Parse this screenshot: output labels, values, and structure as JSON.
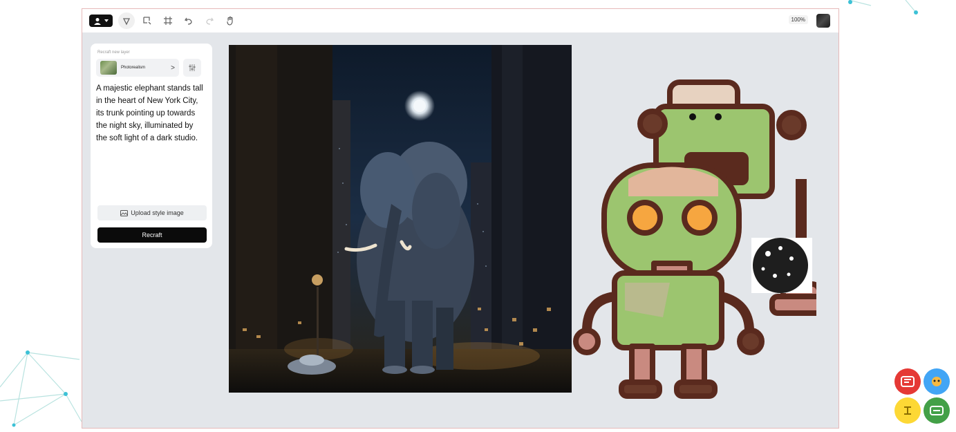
{
  "toolbar": {
    "tools": [
      {
        "icon": "lasso-select-icon"
      },
      {
        "icon": "crop-region-icon"
      },
      {
        "icon": "frame-icon"
      },
      {
        "icon": "undo-icon"
      },
      {
        "icon": "redo-icon",
        "disabled": true
      },
      {
        "icon": "hand-pan-icon"
      }
    ],
    "zoom": "100%"
  },
  "panel": {
    "title": "Recraft new layer",
    "style_label": "Photorealism",
    "style_chevron": ">",
    "prompt": "A majestic elephant stands tall in the heart of New York City, its trunk pointing up towards the night sky, illuminated by the soft light of a dark studio.",
    "upload_label": "Upload style image",
    "recraft_label": "Recraft"
  },
  "colors": {
    "accent": "#0b0b0b",
    "canvas_bg": "#e3e6ea",
    "robot_green": "#9cc56f",
    "robot_outline": "#5a2a1e",
    "robot_eye": "#f6a640"
  }
}
